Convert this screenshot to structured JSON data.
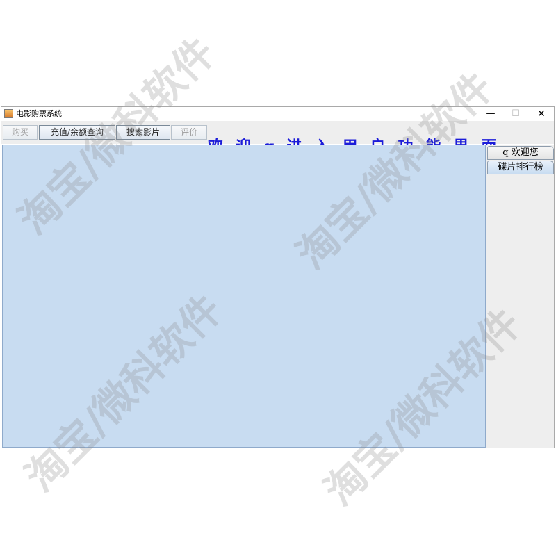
{
  "window": {
    "title": "电影购票系统",
    "controls": {
      "minimize": "—",
      "maximize": "☐",
      "close": "✕"
    }
  },
  "toolbar": {
    "buttons": [
      {
        "label": "购买",
        "enabled": false
      },
      {
        "label": "充值/余额查询",
        "enabled": true
      },
      {
        "label": "搜索影片",
        "enabled": true
      },
      {
        "label": "评价",
        "enabled": false
      }
    ],
    "welcome_text": "欢迎q进入用户功能界面",
    "welcome_color": "#1c1cd9"
  },
  "side_tabs": [
    {
      "label": "q 欢迎您",
      "selected": false
    },
    {
      "label": "碟片排行榜",
      "selected": true
    }
  ],
  "watermark": {
    "text": "淘宝/微科软件"
  },
  "colors": {
    "content_bg": "#c8dcf1",
    "panel_bg": "#eeeeee"
  }
}
